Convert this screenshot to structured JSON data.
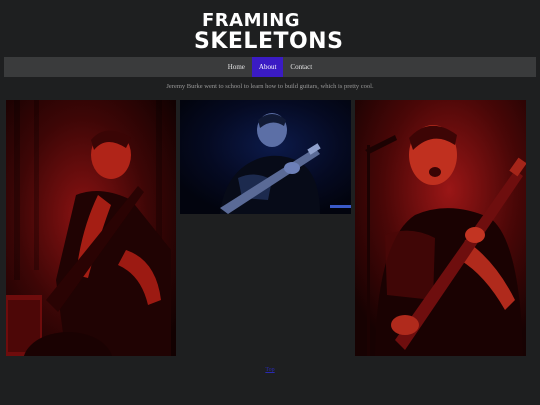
{
  "brand": {
    "logo_line1": "FRAMING",
    "logo_line2": "SKELETONS",
    "logo_color": "#ffffff"
  },
  "nav": {
    "items": [
      {
        "label": "Home",
        "active": false
      },
      {
        "label": "About",
        "active": true
      },
      {
        "label": "Contact",
        "active": false
      }
    ],
    "active_color": "#3a1bc4"
  },
  "about": {
    "text": "Jeremy Burke went to school to learn how to build guitars, which is pretty cool."
  },
  "photos": [
    {
      "name": "guitarist-red-left"
    },
    {
      "name": "guitarist-blue-center"
    },
    {
      "name": "guitarist-red-right"
    }
  ],
  "footer": {
    "link_text": "Top"
  }
}
